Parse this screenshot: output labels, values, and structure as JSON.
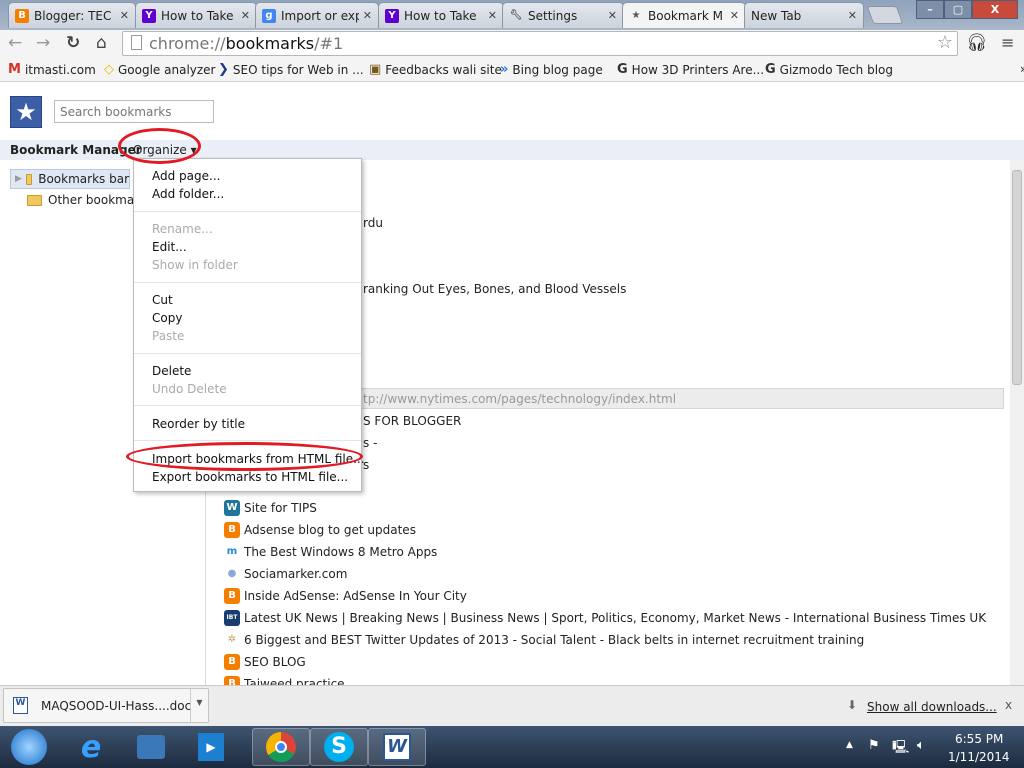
{
  "tabs": [
    {
      "title": "Blogger: TEC",
      "icon": "blogger-icon",
      "color": "#f57d00"
    },
    {
      "title": "How to Take",
      "icon": "yahoo-icon",
      "color": "#5f01d1"
    },
    {
      "title": "Import or exp",
      "icon": "google-icon",
      "color": "#4285f4"
    },
    {
      "title": "How to Take",
      "icon": "yahoo-icon",
      "color": "#5f01d1"
    },
    {
      "title": "Settings",
      "icon": "wrench-icon",
      "color": "#666666"
    },
    {
      "title": "Bookmark M",
      "icon": "star-icon",
      "color": "#555555"
    },
    {
      "title": "New Tab",
      "icon": "",
      "color": ""
    }
  ],
  "window": {
    "minimize": "–",
    "maximize": "▢",
    "close": "X"
  },
  "omnibox": {
    "scheme": "chrome://",
    "host": "bookmarks",
    "path": "/#1"
  },
  "bookmarks_bar": [
    {
      "label": "itmasti.com",
      "glyph": "M",
      "color": "#d93025"
    },
    {
      "label": "Google analyzer",
      "glyph": "◇",
      "color": "#f4b400"
    },
    {
      "label": "SEO  tips for Web in ...",
      "glyph": "❯",
      "color": "#1a3a8a"
    },
    {
      "label": "Feedbacks wali site",
      "glyph": "▣",
      "color": "#7a5a1a"
    },
    {
      "label": "Bing blog page",
      "glyph": "»",
      "color": "#2f7ad6"
    },
    {
      "label": "How 3D Printers Are...",
      "glyph": "G",
      "color": "#333"
    },
    {
      "label": "Gizmodo Tech blog",
      "glyph": "G",
      "color": "#333"
    }
  ],
  "bookmarks_bar_overflow": "»",
  "search": {
    "placeholder": "Search bookmarks"
  },
  "manager": {
    "title": "Bookmark Manager",
    "organize": "Organize ▾"
  },
  "tree": [
    {
      "label": "Bookmarks bar",
      "selected": true
    },
    {
      "label": "Other bookmarks",
      "selected": false
    }
  ],
  "list_partial": {
    "row3": "rdu",
    "row6": "ranking Out Eyes, Bones, and Blood Vessels",
    "url": "tp://www.nytimes.com/pages/technology/index.html",
    "row12": "S FOR BLOGGER",
    "row13": "s -",
    "row14": "s"
  },
  "list": [
    {
      "label": "Site for TIPS",
      "icon": "wordpress-icon",
      "glyph": "W",
      "color": "#21759b"
    },
    {
      "label": "Adsense blog to get updates",
      "icon": "blogger-icon",
      "glyph": "B",
      "color": "#f57d00"
    },
    {
      "label": "The Best Windows 8 Metro Apps",
      "icon": "metro-icon",
      "glyph": "m",
      "color": "#1e88e5"
    },
    {
      "label": "Sociamarker.com",
      "icon": "people-icon",
      "glyph": "●",
      "color": "#8aa8d8"
    },
    {
      "label": "Inside AdSense: AdSense In Your City",
      "icon": "blogger-icon",
      "glyph": "B",
      "color": "#f57d00"
    },
    {
      "label": "Latest UK News | Breaking News | Business News | Sport, Politics, Economy, Market News - International Business Times UK",
      "icon": "ibt-icon",
      "glyph": "IBT",
      "color": "#1b3c6e"
    },
    {
      "label": "6 Biggest and BEST Twitter Updates of 2013 - Social Talent - Black belts in internet recruitment training",
      "icon": "sparkle-icon",
      "glyph": "✲",
      "color": "#c8a070"
    },
    {
      "label": "SEO BLOG",
      "icon": "blogger-icon",
      "glyph": "B",
      "color": "#f57d00"
    },
    {
      "label": "Tajweed practice",
      "icon": "blogger-icon",
      "glyph": "B",
      "color": "#f57d00"
    }
  ],
  "menu": [
    {
      "label": "Add page...",
      "disabled": false
    },
    {
      "label": "Add folder...",
      "disabled": false
    },
    {
      "label": "Rename...",
      "disabled": true
    },
    {
      "label": "Edit...",
      "disabled": false
    },
    {
      "label": "Show in folder",
      "disabled": true
    },
    {
      "label": "Cut",
      "disabled": false
    },
    {
      "label": "Copy",
      "disabled": false
    },
    {
      "label": "Paste",
      "disabled": true
    },
    {
      "label": "Delete",
      "disabled": false
    },
    {
      "label": "Undo Delete",
      "disabled": true
    },
    {
      "label": "Reorder by title",
      "disabled": false
    },
    {
      "label": "Import bookmarks from HTML file...",
      "disabled": false
    },
    {
      "label": "Export bookmarks to HTML file...",
      "disabled": false
    }
  ],
  "annotation_color": "#e01b24",
  "downloads": {
    "file": "MAQSOOD-UI-Hass....doc",
    "show_all": "Show all downloads...",
    "close": "x"
  },
  "taskbar": {
    "time": "6:55 PM",
    "date": "1/11/2014"
  }
}
